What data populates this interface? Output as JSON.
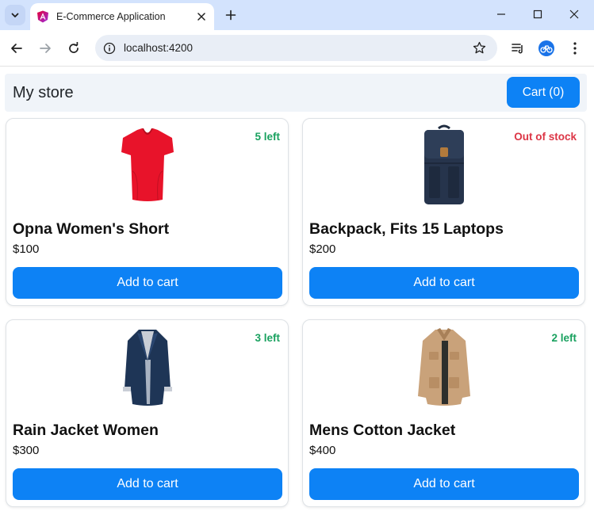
{
  "browser": {
    "tab_title": "E-Commerce Application",
    "url": "localhost:4200"
  },
  "store": {
    "title": "My store",
    "cart_label": "Cart (0)"
  },
  "products": [
    {
      "name": "Opna Women's Short",
      "price": "$100",
      "stock": "5 left",
      "stock_status": "in",
      "button": "Add to cart",
      "image_icon": "red-tshirt-icon"
    },
    {
      "name": "Backpack, Fits 15 Laptops",
      "price": "$200",
      "stock": "Out of stock",
      "stock_status": "out",
      "button": "Add to cart",
      "image_icon": "navy-backpack-icon"
    },
    {
      "name": "Rain Jacket Women",
      "price": "$300",
      "stock": "3 left",
      "stock_status": "in",
      "button": "Add to cart",
      "image_icon": "navy-coat-icon"
    },
    {
      "name": "Mens Cotton Jacket",
      "price": "$400",
      "stock": "2 left",
      "stock_status": "in",
      "button": "Add to cart",
      "image_icon": "tan-jacket-icon"
    }
  ],
  "colors": {
    "primary": "#0d82f5",
    "in_stock": "#19a15f",
    "out_of_stock": "#dc3545",
    "tabstrip": "#d3e3fd"
  }
}
